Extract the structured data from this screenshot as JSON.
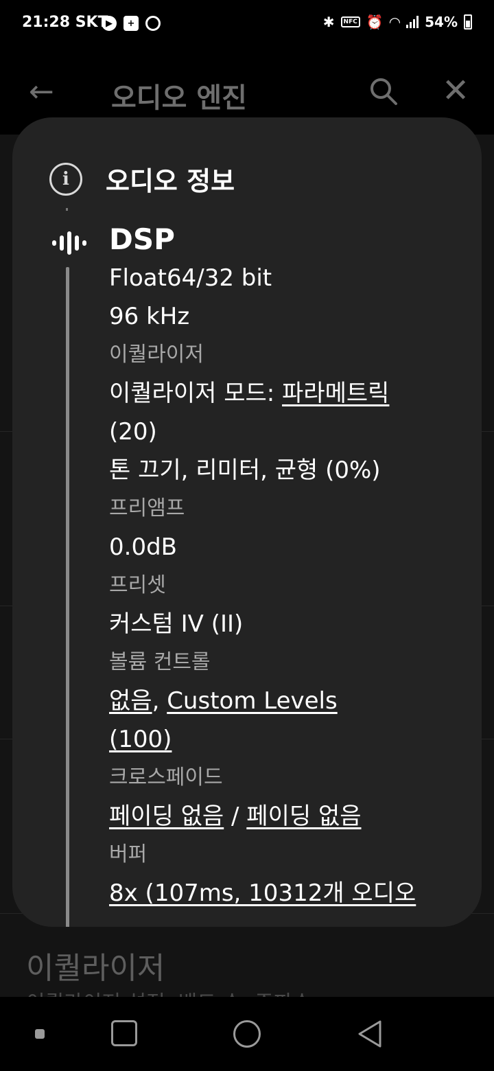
{
  "status_bar": {
    "time": "21:28",
    "carrier": "SKT",
    "battery": "54%"
  },
  "app_bar": {
    "title": "오디오 엔진"
  },
  "background": {
    "eq_title": "이퀄라이저",
    "eq_subtitle": "이퀄라이저 설정, 밴드 수, 주파수"
  },
  "dialog": {
    "title": "오디오 정보",
    "dsp_title": "DSP",
    "format": "Float64/32 bit",
    "sample_rate": "96 kHz",
    "eq_label": "이퀄라이저",
    "eq_mode_prefix": "이퀄라이저 모드: ",
    "eq_mode_value": "파라메트릭",
    "eq_mode_count": "(20)",
    "eq_features": "톤 끄기, 리미터, 균형 (0%)",
    "preamp_label": "프리앰프",
    "preamp_value": "0.0dB",
    "preset_label": "프리셋",
    "preset_value": "커스텀 IV (II)",
    "volume_label": "볼륨 컨트롤",
    "volume_value_1": "없음",
    "volume_sep": ", ",
    "volume_value_2": "Custom Levels",
    "volume_value_3": "(100)",
    "crossfade_label": "크로스페이드",
    "crossfade_value_1": "페이딩 없음",
    "crossfade_sep": " / ",
    "crossfade_value_2": "페이딩 없음",
    "buffer_label": "버퍼",
    "buffer_value": "8x (107ms, 10312개 오디오"
  }
}
